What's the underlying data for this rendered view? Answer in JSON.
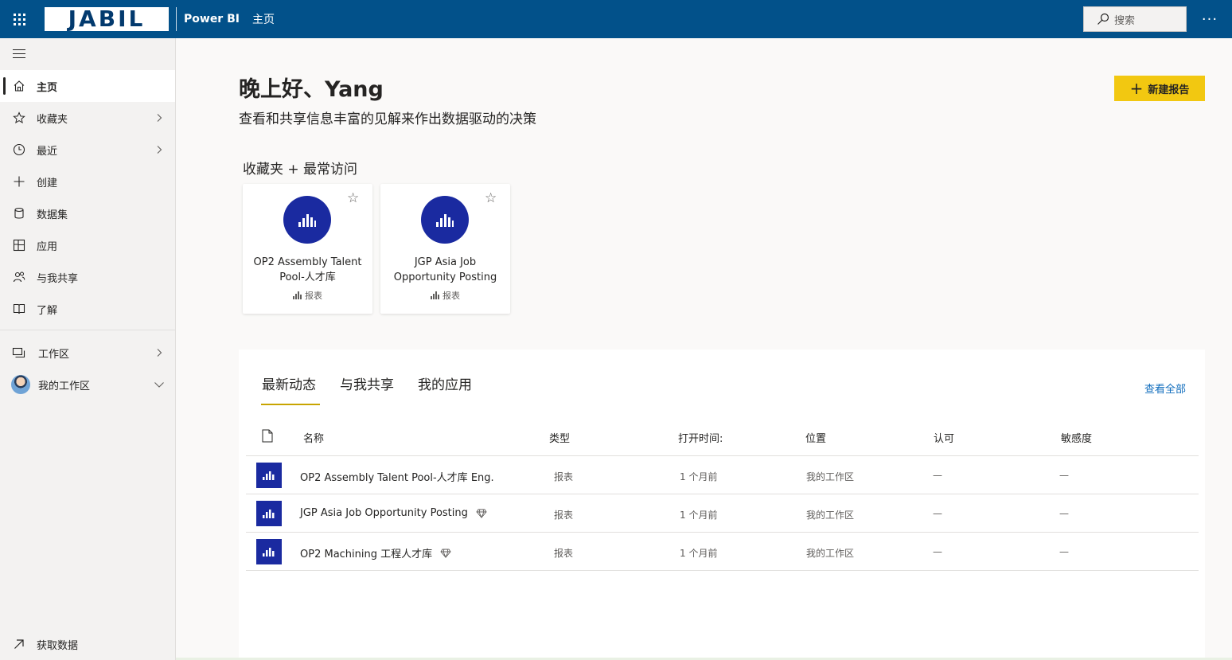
{
  "topbar": {
    "logo_text": "JABIL",
    "app_name": "Power BI",
    "breadcrumb": "主页",
    "search_placeholder": "搜索",
    "more_label": "···"
  },
  "sidebar": {
    "items": [
      {
        "label": "主页",
        "icon": "home-icon",
        "active": true
      },
      {
        "label": "收藏夹",
        "icon": "star-icon",
        "chevron": "right"
      },
      {
        "label": "最近",
        "icon": "clock-icon",
        "chevron": "right"
      },
      {
        "label": "创建",
        "icon": "plus-icon"
      },
      {
        "label": "数据集",
        "icon": "database-icon"
      },
      {
        "label": "应用",
        "icon": "apps-icon"
      },
      {
        "label": "与我共享",
        "icon": "people-icon"
      },
      {
        "label": "了解",
        "icon": "book-icon"
      }
    ],
    "workspaces": [
      {
        "label": "工作区",
        "icon": "workspace-icon",
        "chevron": "right"
      },
      {
        "label": "我的工作区",
        "icon": "avatar",
        "chevron": "down"
      }
    ],
    "get_data": "获取数据"
  },
  "main": {
    "greeting": "晚上好、Yang",
    "subtitle": "查看和共享信息丰富的见解来作出数据驱动的决策",
    "new_report_label": "新建报告",
    "favorites_title": "收藏夹 + 最常访问",
    "cards": [
      {
        "title": "OP2 Assembly Talent Pool-人才库",
        "type": "报表"
      },
      {
        "title": "JGP Asia Job Opportunity Posting",
        "type": "报表"
      }
    ]
  },
  "panel": {
    "tabs": [
      "最新动态",
      "与我共享",
      "我的应用"
    ],
    "view_all": "查看全部",
    "columns": [
      "名称",
      "类型",
      "打开时间:",
      "位置",
      "认可",
      "敏感度"
    ],
    "rows": [
      {
        "name": "OP2 Assembly Talent Pool-人才库 Eng.",
        "type": "报表",
        "opened": "1 个月前",
        "location": "我的工作区",
        "endorsement": "—",
        "sensitivity": "—",
        "gem": false
      },
      {
        "name": "JGP Asia Job Opportunity Posting",
        "type": "报表",
        "opened": "1 个月前",
        "location": "我的工作区",
        "endorsement": "—",
        "sensitivity": "—",
        "gem": true
      },
      {
        "name": "OP2 Machining 工程人才库",
        "type": "报表",
        "opened": "1 个月前",
        "location": "我的工作区",
        "endorsement": "—",
        "sensitivity": "—",
        "gem": true
      }
    ]
  },
  "colors": {
    "topbar": "#02518a",
    "accent_yellow": "#f2c811",
    "report_icon": "#1a2aa0",
    "link": "#0f6cbd"
  }
}
